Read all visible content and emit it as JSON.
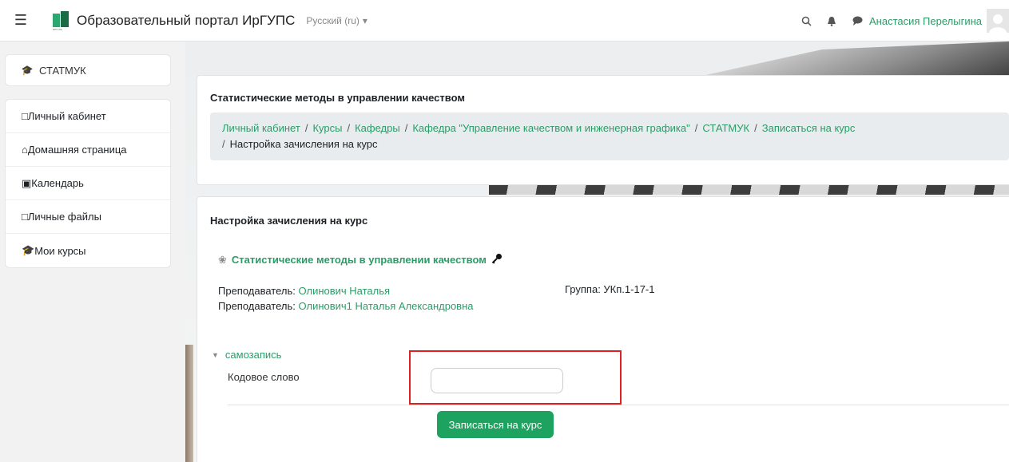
{
  "navbar": {
    "site_name": "Образовательный портал ИрГУПС",
    "logo_text": "ИРГУПС",
    "language": "Русский (ru)",
    "user_name": "Анастасия Перелыгина"
  },
  "sidebar": {
    "course_item": "СТАТМУК",
    "items": [
      {
        "label": "Личный кабинет",
        "icon": "square-icon"
      },
      {
        "label": "Домашняя страница",
        "icon": "home-icon"
      },
      {
        "label": "Календарь",
        "icon": "calendar-icon"
      },
      {
        "label": "Личные файлы",
        "icon": "square-icon"
      }
    ],
    "my_courses": "Мои курсы"
  },
  "header": {
    "title": "Статистические методы в управлении качеством",
    "breadcrumbs": [
      "Личный кабинет",
      "Курсы",
      "Кафедры",
      "Кафедра \"Управление качеством и инженерная графика\"",
      "СТАТМУК",
      "Записаться на курс"
    ],
    "breadcrumb_current": "Настройка зачисления на курс"
  },
  "main": {
    "section_title": "Настройка зачисления на курс",
    "course_name": "Статистические методы в управлении качеством",
    "teacher_label": "Преподаватель:",
    "teachers": [
      "Олинович Наталья",
      "Олинович1 Наталья Александровна"
    ],
    "group": "Группа: УКп.1-17-1",
    "fieldset": "самозапись",
    "code_label": "Кодовое слово",
    "code_value": "",
    "submit_label": "Записаться на курс"
  },
  "colors": {
    "accent": "#2b9c67",
    "button": "#1ea25f",
    "highlight": "#e02020"
  }
}
